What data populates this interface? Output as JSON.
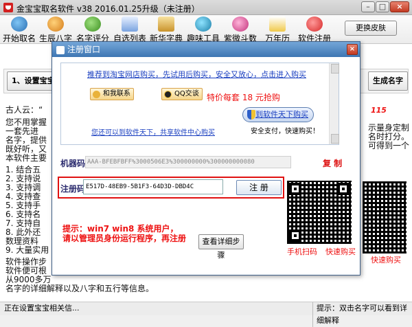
{
  "window": {
    "title": "金宝宝取名软件 v38  2016.01.25升级（未注册）"
  },
  "toolbar": {
    "items": [
      {
        "label": "开始取名",
        "icon": "people-icon"
      },
      {
        "label": "生辰八字",
        "icon": "person-icon"
      },
      {
        "label": "名字评分",
        "icon": "person-icon"
      },
      {
        "label": "自选列表",
        "icon": "list-icon"
      },
      {
        "label": "新华字典",
        "icon": "book-icon"
      },
      {
        "label": "趣味工具",
        "icon": "globe-icon"
      },
      {
        "label": "紫微斗数",
        "icon": "star-icon"
      },
      {
        "label": "万年历",
        "icon": "calendar-icon"
      },
      {
        "label": "软件注册",
        "icon": "flower-icon"
      }
    ],
    "skin_button": "更换皮肤"
  },
  "main": {
    "step1_button": "1、设置宝宝",
    "generate_button": "生成名字",
    "bg_text": [
      "古人云：“",
      "您不用掌握",
      "一套先进",
      "名字，提供",
      "既好听，又",
      "本软件主要",
      "1. 结合五",
      "2. 支持说",
      "3. 支持调",
      "4. 支持查",
      "5. 支持手",
      "6. 支持名",
      "7. 支持自",
      "8. 此外还",
      "   数理资料",
      "9. 大量实用",
      "软件操作步",
      "软件便可根",
      "从9000多万",
      "名字的详细解释以及八字和五行等信息。"
    ],
    "bg_right_text": [
      "示量身定制",
      "名时打分。",
      "可得到一个"
    ],
    "bg_red_text": "115"
  },
  "dialog": {
    "title": "注册窗口",
    "taobao_link": "推荐到淘宝网店购买，先试用后购买，安全又放心，点击进入购买",
    "contact_chip": "和我联系",
    "qq_chip": "QQ交谈",
    "price_text": "特价每套 18 元抢购",
    "buy_link": "到软件天下购买",
    "pay_caption": "安全支付，快速购买！",
    "center_link": "您还可以到软件天下，共享软件中心购买",
    "machine_code_label": "机器码：",
    "machine_code_value": "AAA-BFEBFBFF%3000506E3%300000000%300000000080",
    "copy_button": "复 制",
    "reg_code_label": "注册码：",
    "reg_code_value": "E517D-48EB9-5B1F3-64D3D-DBD4C",
    "register_button": "注 册",
    "warning": [
      "提示：win7 win8 系统用户，",
      "请以管理员身份运行程序，再注册"
    ],
    "detail_button": "查看详细步骤",
    "qr_caption_left": "手机扫码",
    "qr_caption_right": "快速购买"
  },
  "status": {
    "left": "正在设置宝宝相关信...",
    "right": "提示：双击名字可以看到详细解释"
  },
  "colors": {
    "accent": "#3e76b3",
    "warning_red": "#e01010",
    "link_blue": "#1a3fc0"
  }
}
